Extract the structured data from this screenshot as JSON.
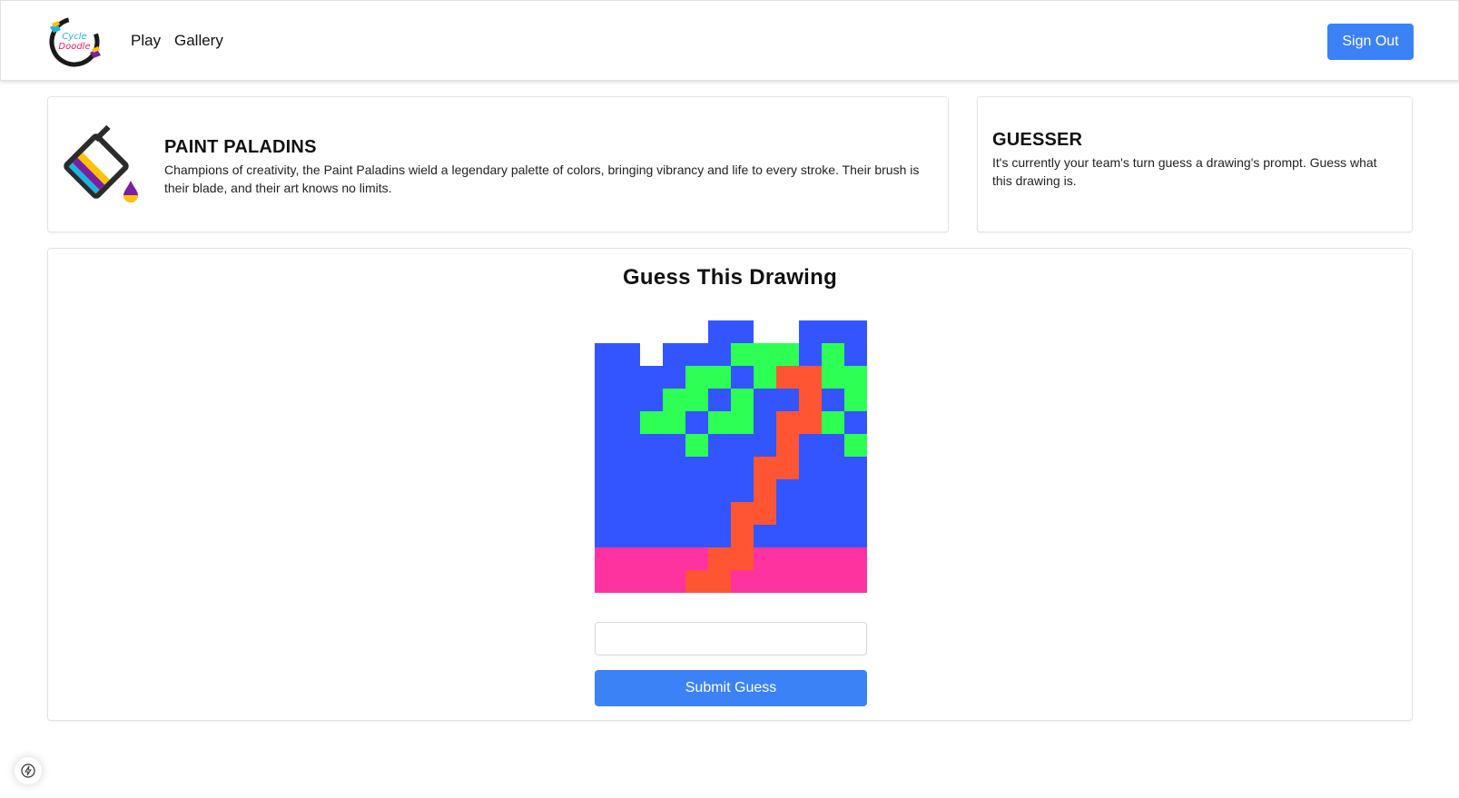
{
  "nav": {
    "logo_text_line1": "Cycle",
    "logo_text_line2": "Doodle",
    "links": [
      "Play",
      "Gallery"
    ],
    "sign_out_label": "Sign Out"
  },
  "team": {
    "name": "PAINT PALADINS",
    "description": "Champions of creativity, the Paint Paladins wield a legendary palette of colors, bringing vibrancy and life to every stroke. Their brush is their blade, and their art knows no limits."
  },
  "role": {
    "title": "GUESSER",
    "description": "It's currently your team's turn guess a drawing's prompt. Guess what this drawing is."
  },
  "main": {
    "title": "Guess This Drawing",
    "input_value": "",
    "input_placeholder": "",
    "submit_label": "Submit Guess"
  },
  "drawing": {
    "palette": {
      "W": "#ffffff",
      "B": "#3355ff",
      "G": "#2eff55",
      "O": "#ff5533",
      "P": "#ff33a0"
    },
    "pixels": [
      "WWWWWBBWWBBB",
      "BBWBBBGGGBGB",
      "BBBBGGBGOOGG",
      "BBBGGBGBBOBG",
      "BBGGBGGBOOGB",
      "BBBBGBBBOBBG",
      "BBBBBBBOOBBB",
      "BBBBBBBOBBBB",
      "BBBBBBOOBBBB",
      "BBBBBBOBBBBB",
      "PPPPPOOPPPPP",
      "PPPPOOPPPPPP"
    ]
  },
  "colors": {
    "accent": "#3b82f6",
    "team_icon_cyan": "#1cb5e0",
    "team_icon_purple": "#7b1fa2",
    "team_icon_yellow": "#ffc107"
  }
}
